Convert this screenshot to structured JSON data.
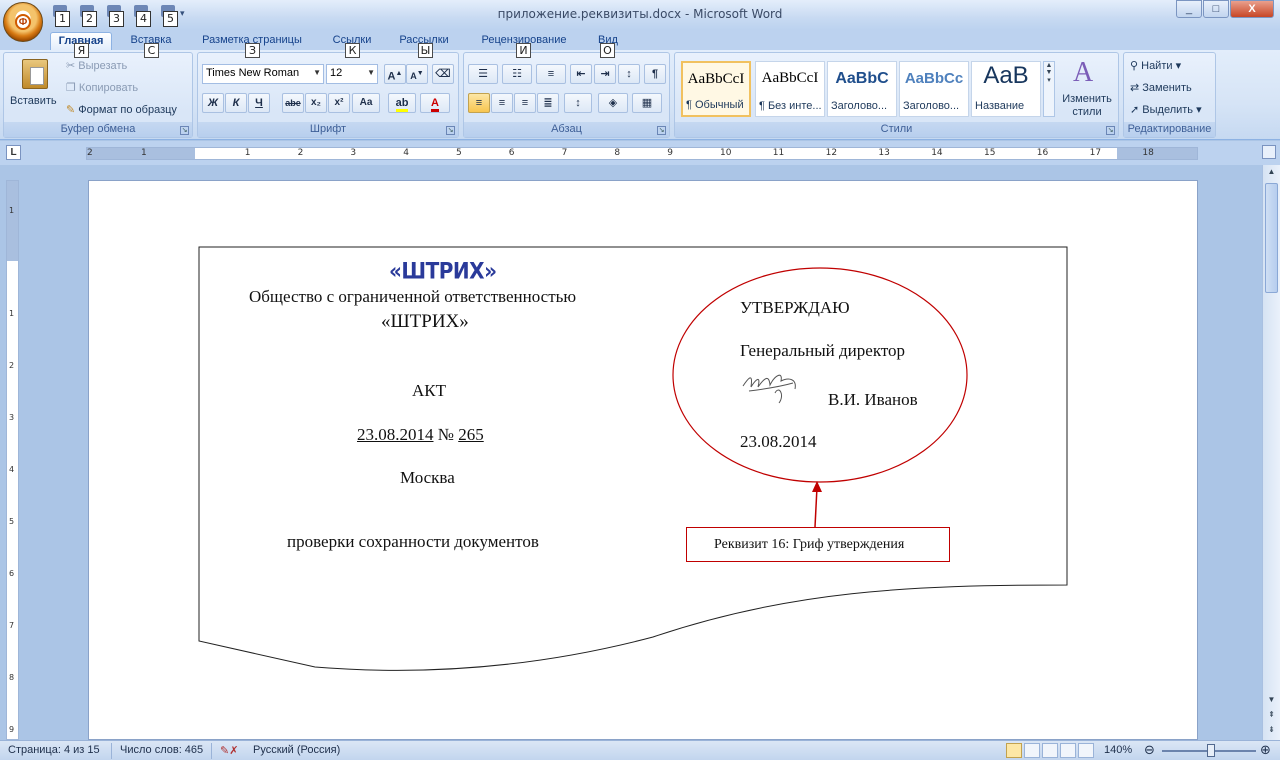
{
  "window": {
    "title": "приложение.реквизиты.docx - Microsoft Word",
    "office_button_keytip": "Ф",
    "qat_keytips": [
      "1",
      "2",
      "3",
      "4",
      "5"
    ],
    "minimize": "_",
    "maximize": "□",
    "close": "X"
  },
  "tabs": [
    {
      "label": "Главная",
      "keytip": "Я"
    },
    {
      "label": "Вставка",
      "keytip": "С"
    },
    {
      "label": "Разметка страницы",
      "keytip": "З"
    },
    {
      "label": "Ссылки",
      "keytip": "К"
    },
    {
      "label": "Рассылки",
      "keytip": "Ы"
    },
    {
      "label": "Рецензирование",
      "keytip": "И"
    },
    {
      "label": "Вид",
      "keytip": "О"
    }
  ],
  "ribbon": {
    "clipboard": {
      "label": "Буфер обмена",
      "paste": "Вставить",
      "cut": "Вырезать",
      "copy": "Копировать",
      "format_painter": "Формат по образцу"
    },
    "font": {
      "label": "Шрифт",
      "family": "Times New Roman",
      "size": "12",
      "bold": "Ж",
      "italic": "К",
      "underline": "Ч",
      "strike": "abe",
      "subscript": "x₂",
      "superscript": "x²",
      "change_case": "Aa",
      "grow": "A",
      "shrink": "A"
    },
    "paragraph": {
      "label": "Абзац"
    },
    "styles": {
      "label": "Стили",
      "items": [
        {
          "sample": "AaBbCcI",
          "name": "¶ Обычный"
        },
        {
          "sample": "AaBbCcI",
          "name": "¶ Без инте..."
        },
        {
          "sample": "AaBbC",
          "name": "Заголово..."
        },
        {
          "sample": "AaBbCc",
          "name": "Заголово..."
        },
        {
          "sample": "AaB",
          "name": "Название"
        }
      ],
      "change_styles": "Изменить стили"
    },
    "editing": {
      "label": "Редактирование",
      "find": "Найти",
      "replace": "Заменить",
      "select": "Выделить"
    }
  },
  "ruler": {
    "corner": "L",
    "numbers": [
      "2",
      "1",
      "1",
      "2",
      "3",
      "4",
      "5",
      "6",
      "7",
      "8",
      "9",
      "10",
      "11",
      "12",
      "13",
      "14",
      "15",
      "16",
      "17",
      "18"
    ],
    "vnumbers": [
      "1",
      "1",
      "2",
      "3",
      "4",
      "5",
      "6",
      "7",
      "8",
      "9"
    ]
  },
  "document": {
    "logo": "«ШТРИХ»",
    "org_line1": "Общество с ограниченной ответственностью",
    "org_line2": "«ШТРИХ»",
    "doc_type": "АКТ",
    "date": "23.08.2014",
    "number_sign": "№",
    "number": "265",
    "city": "Москва",
    "subject": "проверки сохранности документов",
    "approve_title": "УТВЕРЖДАЮ",
    "approve_position": "Генеральный директор",
    "approve_name": "В.И. Иванов",
    "approve_date": "23.08.2014",
    "callout": "Реквизит 16: Гриф утверждения"
  },
  "statusbar": {
    "page": "Страница: 4 из 15",
    "words": "Число слов: 465",
    "language": "Русский (Россия)",
    "zoom": "140%"
  },
  "colors": {
    "accent": "#15428b",
    "logo": "#2a3a9a",
    "callout": "#c00000"
  }
}
